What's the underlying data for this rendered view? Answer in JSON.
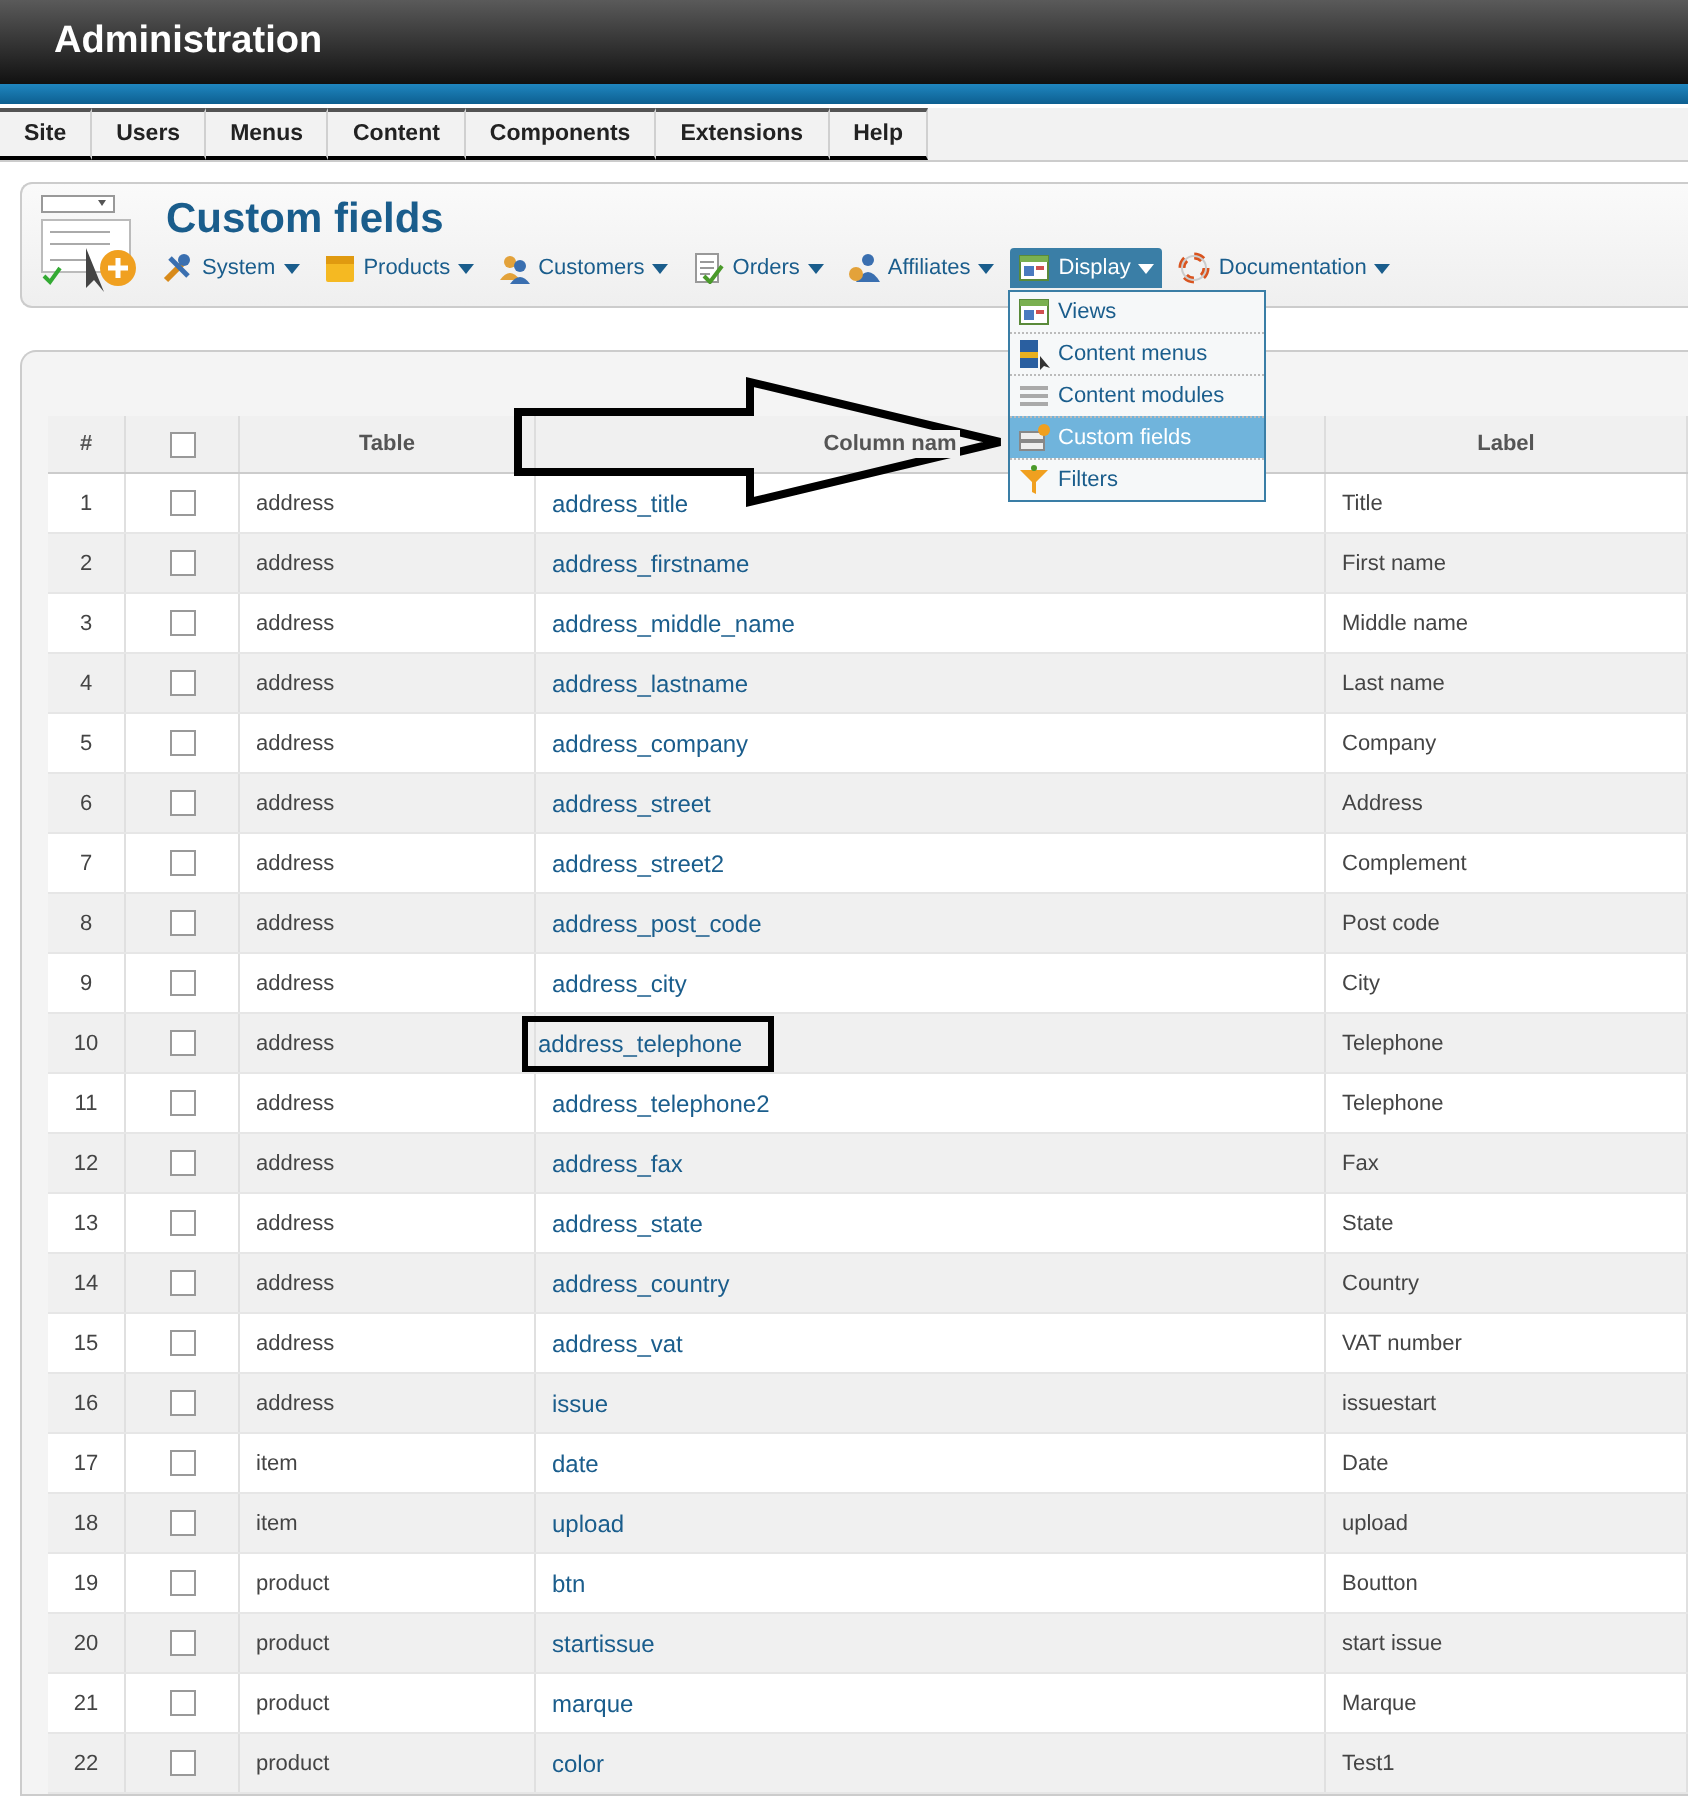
{
  "window": {
    "title": "Administration"
  },
  "menu": [
    {
      "label": "Site"
    },
    {
      "label": "Users"
    },
    {
      "label": "Menus"
    },
    {
      "label": "Content"
    },
    {
      "label": "Components"
    },
    {
      "label": "Extensions"
    },
    {
      "label": "Help"
    }
  ],
  "page": {
    "title": "Custom fields"
  },
  "toolbar": [
    {
      "label": "System",
      "selected": false
    },
    {
      "label": "Products",
      "selected": false
    },
    {
      "label": "Customers",
      "selected": false
    },
    {
      "label": "Orders",
      "selected": false
    },
    {
      "label": "Affiliates",
      "selected": false
    },
    {
      "label": "Display",
      "selected": true
    },
    {
      "label": "Documentation",
      "selected": false
    }
  ],
  "dropdown": [
    {
      "label": "Views",
      "selected": false
    },
    {
      "label": "Content menus",
      "selected": false
    },
    {
      "label": "Content modules",
      "selected": false
    },
    {
      "label": "Custom fields",
      "selected": true
    },
    {
      "label": "Filters",
      "selected": false
    }
  ],
  "table": {
    "columns": [
      "#",
      "Table",
      "Column nam",
      "Label"
    ],
    "header_checked": false,
    "rows": [
      {
        "n": "1",
        "table": "address",
        "column": "address_title",
        "label": "Title",
        "checked": false,
        "highlighted": false
      },
      {
        "n": "2",
        "table": "address",
        "column": "address_firstname",
        "label": "First name",
        "checked": false,
        "highlighted": false
      },
      {
        "n": "3",
        "table": "address",
        "column": "address_middle_name",
        "label": "Middle name",
        "checked": false,
        "highlighted": false
      },
      {
        "n": "4",
        "table": "address",
        "column": "address_lastname",
        "label": "Last name",
        "checked": false,
        "highlighted": false
      },
      {
        "n": "5",
        "table": "address",
        "column": "address_company",
        "label": "Company",
        "checked": false,
        "highlighted": false
      },
      {
        "n": "6",
        "table": "address",
        "column": "address_street",
        "label": "Address",
        "checked": false,
        "highlighted": false
      },
      {
        "n": "7",
        "table": "address",
        "column": "address_street2",
        "label": "Complement",
        "checked": false,
        "highlighted": false
      },
      {
        "n": "8",
        "table": "address",
        "column": "address_post_code",
        "label": "Post code",
        "checked": false,
        "highlighted": false
      },
      {
        "n": "9",
        "table": "address",
        "column": "address_city",
        "label": "City",
        "checked": false,
        "highlighted": false
      },
      {
        "n": "10",
        "table": "address",
        "column": "address_telephone",
        "label": "Telephone",
        "checked": false,
        "highlighted": true
      },
      {
        "n": "11",
        "table": "address",
        "column": "address_telephone2",
        "label": "Telephone",
        "checked": false,
        "highlighted": false
      },
      {
        "n": "12",
        "table": "address",
        "column": "address_fax",
        "label": "Fax",
        "checked": false,
        "highlighted": false
      },
      {
        "n": "13",
        "table": "address",
        "column": "address_state",
        "label": "State",
        "checked": false,
        "highlighted": false
      },
      {
        "n": "14",
        "table": "address",
        "column": "address_country",
        "label": "Country",
        "checked": false,
        "highlighted": false
      },
      {
        "n": "15",
        "table": "address",
        "column": "address_vat",
        "label": "VAT number",
        "checked": false,
        "highlighted": false
      },
      {
        "n": "16",
        "table": "address",
        "column": "issue",
        "label": "issuestart",
        "checked": false,
        "highlighted": false
      },
      {
        "n": "17",
        "table": "item",
        "column": "date",
        "label": "Date",
        "checked": false,
        "highlighted": false
      },
      {
        "n": "18",
        "table": "item",
        "column": "upload",
        "label": "upload",
        "checked": false,
        "highlighted": false
      },
      {
        "n": "19",
        "table": "product",
        "column": "btn",
        "label": "Boutton",
        "checked": false,
        "highlighted": false
      },
      {
        "n": "20",
        "table": "product",
        "column": "startissue",
        "label": "start issue",
        "checked": false,
        "highlighted": false
      },
      {
        "n": "21",
        "table": "product",
        "column": "marque",
        "label": "Marque",
        "checked": false,
        "highlighted": false
      },
      {
        "n": "22",
        "table": "product",
        "column": "color",
        "label": "Test1",
        "checked": false,
        "highlighted": false
      }
    ]
  }
}
